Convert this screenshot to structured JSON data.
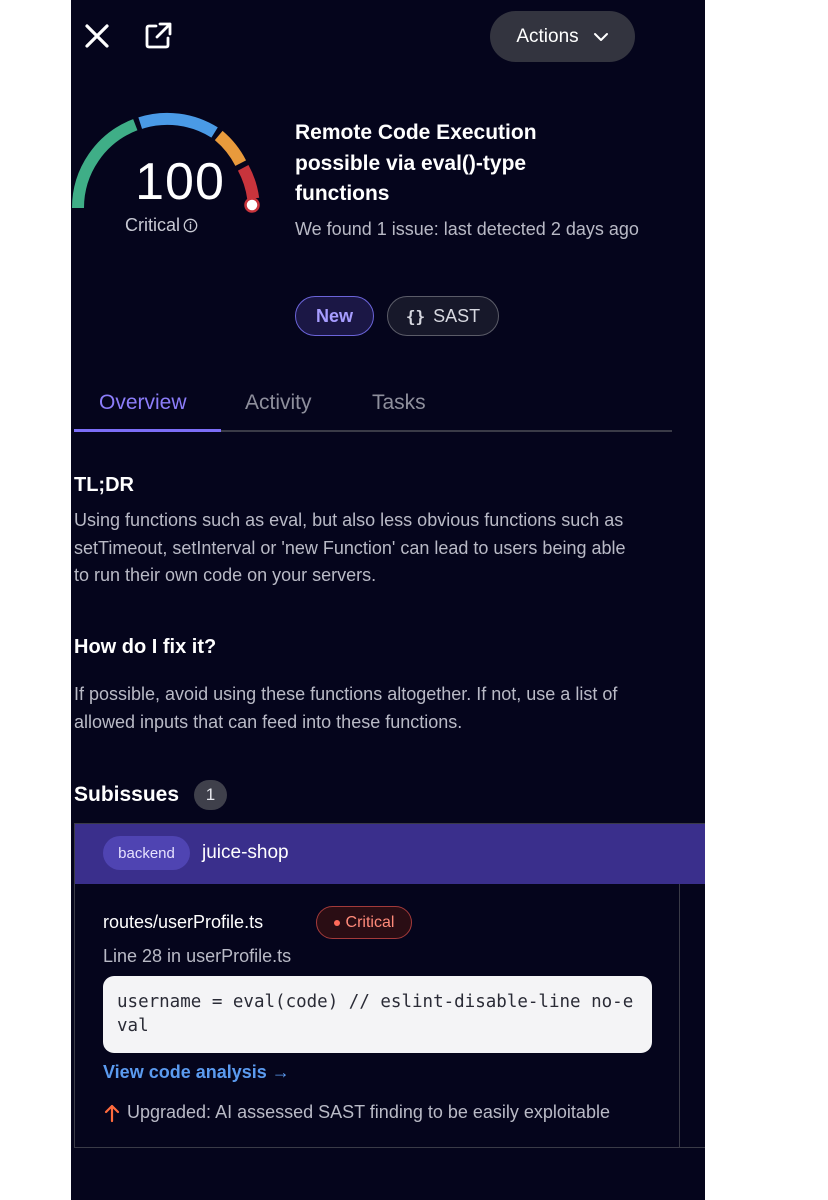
{
  "header": {
    "close_icon": "close-icon",
    "external_link_icon": "external-link-icon",
    "actions_label": "Actions",
    "actions_icon": "chevron-down-icon"
  },
  "score": {
    "value": "100",
    "label": "Critical",
    "info_icon": "info-icon"
  },
  "issue": {
    "title": "Remote Code Execution possible via eval()-type functions",
    "subtitle": "We found 1 issue: last detected 2 days ago",
    "status_badge": "New",
    "type_badge_icon": "{}",
    "type_badge": "SAST"
  },
  "tabs": [
    {
      "label": "Overview",
      "active": true
    },
    {
      "label": "Activity",
      "active": false
    },
    {
      "label": "Tasks",
      "active": false
    }
  ],
  "overview": {
    "tldr_heading": "TL;DR",
    "tldr_text": "Using functions such as eval, but also less obvious functions such as setTimeout, setInterval or 'new Function' can lead to users being able to run their own code on your servers.",
    "fix_heading": "How do I fix it?",
    "fix_text": "If possible, avoid using these functions altogether. If not, use a list of allowed inputs that can feed into these functions."
  },
  "subissues": {
    "heading": "Subissues",
    "count": "1",
    "group_tag": "backend",
    "repo": "juice-shop",
    "items": [
      {
        "file": "routes/userProfile.ts",
        "severity": "Critical",
        "line_info": "Line 28 in userProfile.ts",
        "code": "username = eval(code) // eslint-disable-line no-eval",
        "link_label": "View code analysis →",
        "upgrade_icon": "arrow-up-icon",
        "upgrade_text": "Upgraded: AI assessed SAST finding to be easily exploitable"
      }
    ]
  },
  "colors": {
    "background": "#05051c",
    "accent": "#7c6ef7",
    "critical": "#ff6a5a",
    "link": "#5b9bf0",
    "upgrade": "#ff6b3d",
    "gauge_green": "#3fae87",
    "gauge_blue": "#4a9ae6",
    "gauge_orange": "#e89a3c",
    "gauge_red": "#c8343c"
  }
}
